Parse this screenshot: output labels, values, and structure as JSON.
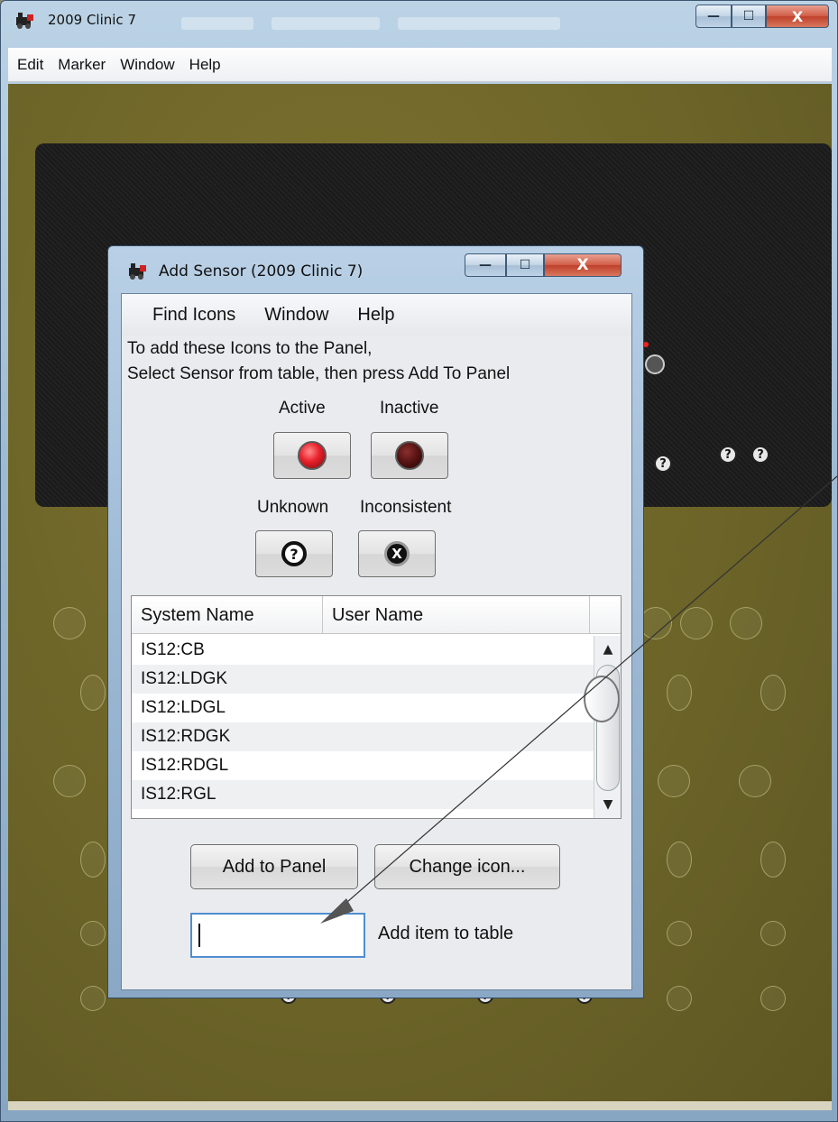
{
  "main_window": {
    "title": "2009 Clinic 7",
    "menu": [
      "Edit",
      "Marker",
      "Window",
      "Help"
    ],
    "controls": {
      "minimize": "—",
      "maximize": "☐",
      "close": "X"
    }
  },
  "dialog": {
    "title": "Add Sensor (2009 Clinic 7)",
    "menu": [
      "Find Icons",
      "Window",
      "Help"
    ],
    "instruction_line1": "To add these Icons to the Panel,",
    "instruction_line2": "Select Sensor from table, then press Add To Panel",
    "states": {
      "active": {
        "label": "Active",
        "color": "#e8202a"
      },
      "inactive": {
        "label": "Inactive",
        "color": "#5a1414"
      },
      "unknown": {
        "label": "Unknown",
        "symbol": "?"
      },
      "inconsistent": {
        "label": "Inconsistent",
        "symbol": "X"
      }
    },
    "table": {
      "columns": [
        "System Name",
        "User Name"
      ],
      "rows": [
        {
          "system_name": "IS12:CB",
          "user_name": ""
        },
        {
          "system_name": "IS12:LDGK",
          "user_name": ""
        },
        {
          "system_name": "IS12:LDGL",
          "user_name": ""
        },
        {
          "system_name": "IS12:RDGK",
          "user_name": ""
        },
        {
          "system_name": "IS12:RDGL",
          "user_name": ""
        },
        {
          "system_name": "IS12:RGL",
          "user_name": ""
        }
      ]
    },
    "add_to_panel_label": "Add to Panel",
    "change_icon_label": "Change icon...",
    "add_item_value": "",
    "add_item_label": "Add item to table",
    "controls": {
      "minimize": "—",
      "maximize": "☐",
      "close": "X"
    }
  },
  "board_icons": {
    "unknown_symbol": "?"
  },
  "colors": {
    "panel_olive": "#6c6428",
    "board_dark": "#1c1c1c",
    "input_focus": "#4f8ed0"
  }
}
